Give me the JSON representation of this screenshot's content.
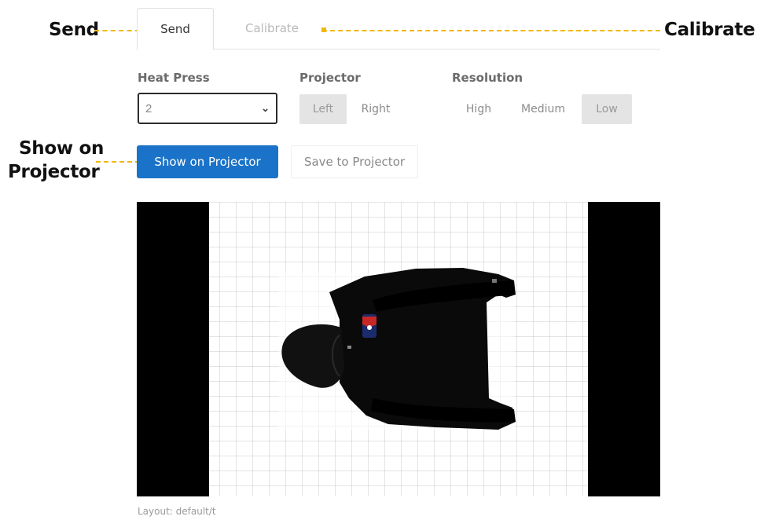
{
  "annotations": {
    "send": "Send",
    "calibrate": "Calibrate",
    "show_on_projector_line1": "Show on",
    "show_on_projector_line2": "Projector",
    "accent_color": "#f2b705"
  },
  "tabs": [
    {
      "label": "Send",
      "active": true
    },
    {
      "label": "Calibrate",
      "active": false
    }
  ],
  "heat_press": {
    "label": "Heat Press",
    "selected": "2"
  },
  "projector": {
    "label": "Projector",
    "options": [
      {
        "label": "Left",
        "active": true
      },
      {
        "label": "Right",
        "active": false
      }
    ]
  },
  "resolution": {
    "label": "Resolution",
    "options": [
      {
        "label": "High",
        "active": false
      },
      {
        "label": "Medium",
        "active": false
      },
      {
        "label": "Low",
        "active": true
      }
    ]
  },
  "actions": {
    "show_on_projector": "Show on Projector",
    "save_to_projector": "Save to Projector",
    "primary_color": "#1a73c8"
  },
  "preview": {
    "image": "hoodie-icon"
  },
  "footer": {
    "layout": "Layout: default/t"
  }
}
